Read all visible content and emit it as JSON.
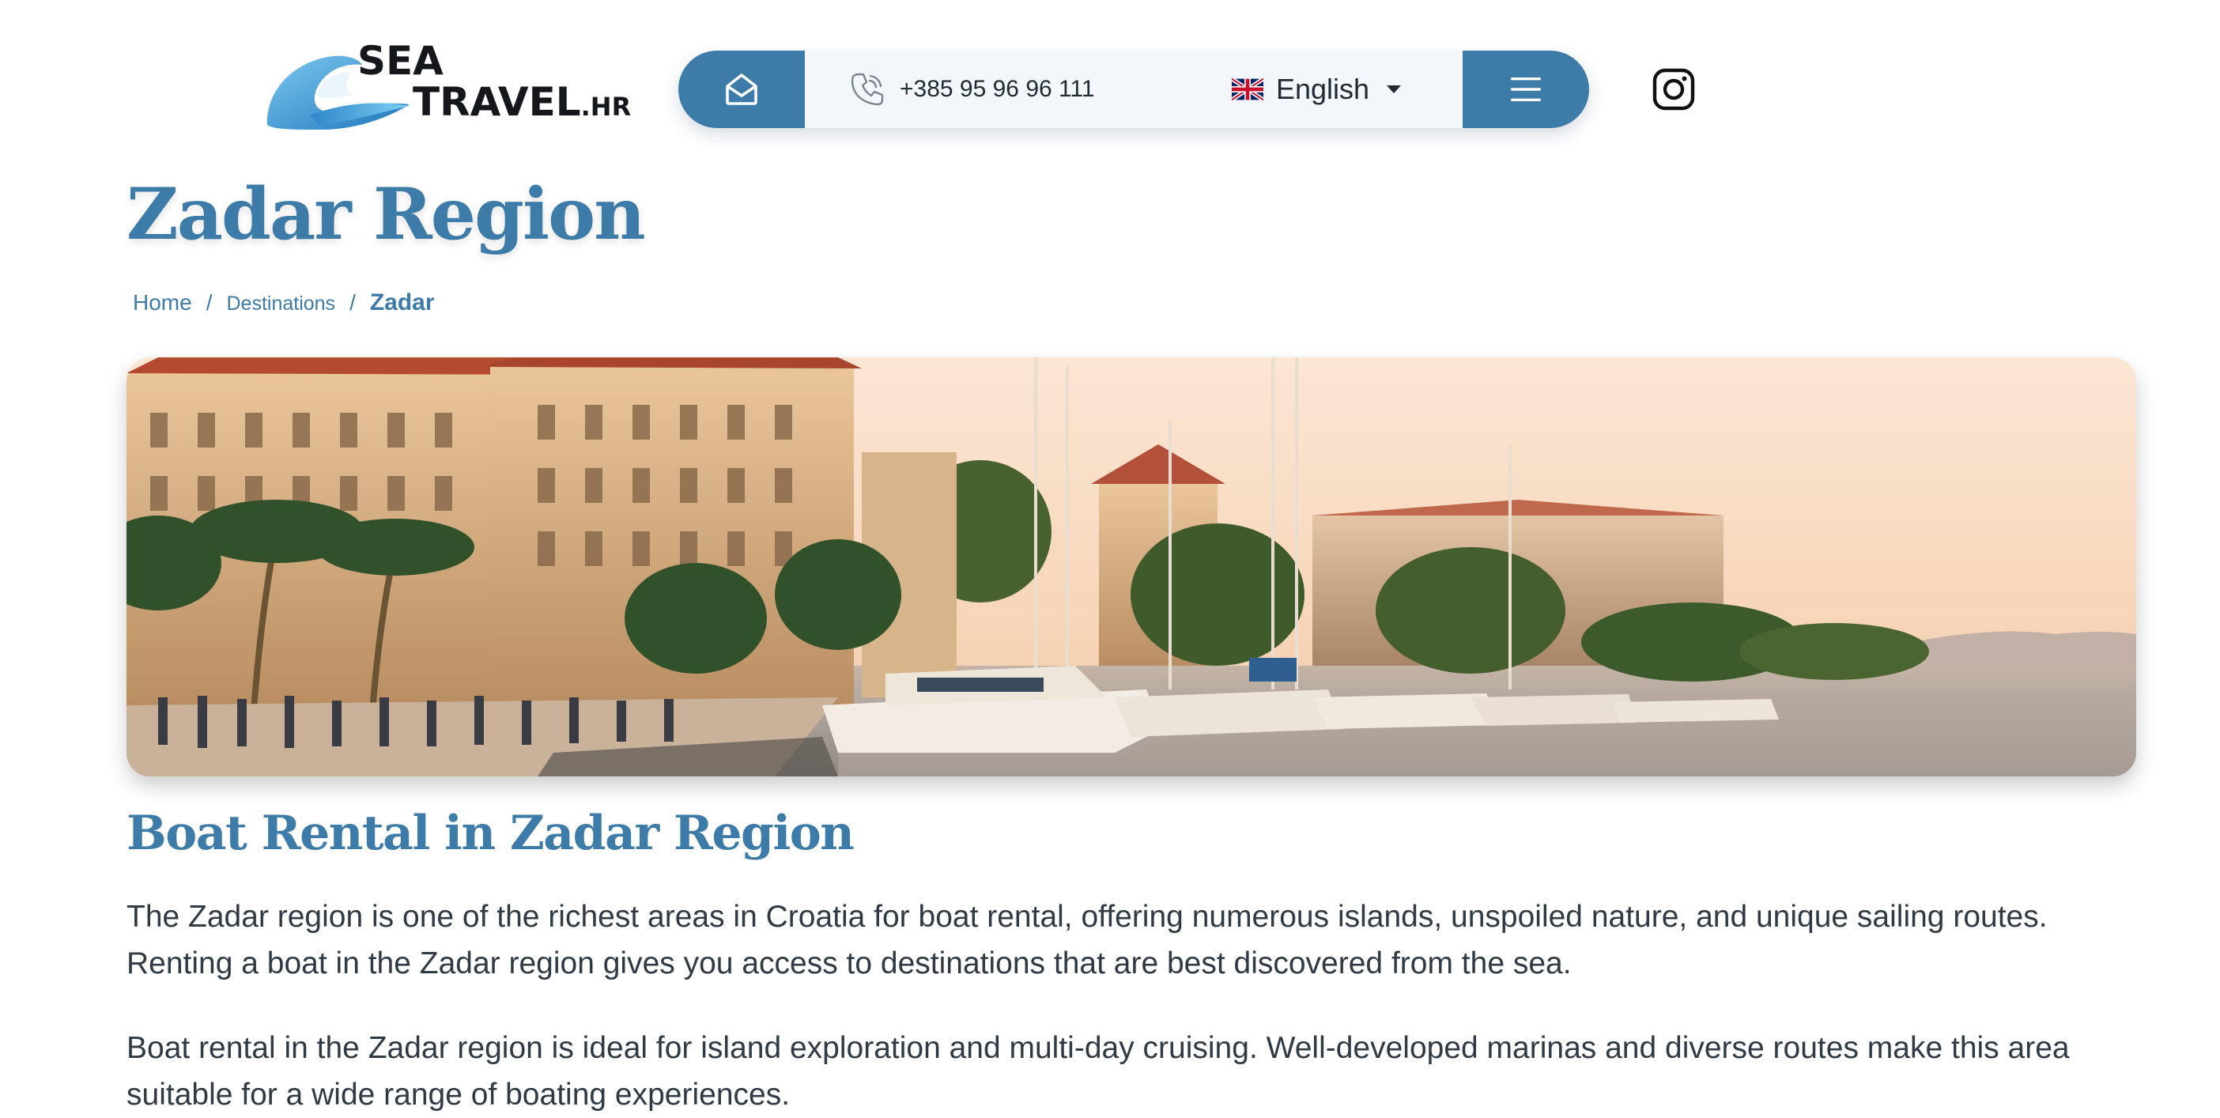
{
  "header": {
    "logo": {
      "line1": "SEA",
      "line2": "TRAVEL",
      "suffix": ".HR"
    },
    "contact": {
      "phone": "+385 95 96 96 111",
      "language": "English"
    },
    "icons": [
      "mail-icon",
      "phone-icon",
      "uk-flag-icon",
      "chevron-down-icon",
      "hamburger-menu-icon",
      "instagram-icon"
    ],
    "colors": {
      "accent": "#3d7ba8",
      "pill_background": "#f3f7fb"
    }
  },
  "page": {
    "title": "Zadar Region",
    "breadcrumb": [
      {
        "label": "Home"
      },
      {
        "label": "Destinations"
      },
      {
        "label": "Zadar"
      }
    ],
    "breadcrumb_separator": "/"
  },
  "content": {
    "section_title": "Boat Rental in Zadar Region",
    "paragraphs": [
      "The Zadar region is one of the richest areas in Croatia for boat rental, offering numerous islands, unspoiled nature, and unique sailing routes. Renting a boat in the Zadar region gives you access to destinations that are best discovered from the sea.",
      "Boat rental in the Zadar region is ideal for island exploration and multi-day cruising. Well-developed marinas and diverse routes make this area suitable for a wide range of boating experiences."
    ]
  }
}
